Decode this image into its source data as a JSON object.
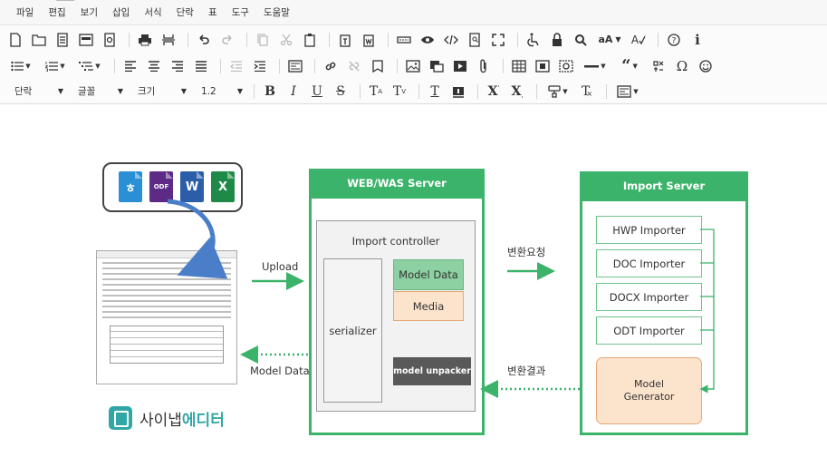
{
  "menubar": {
    "items": [
      "파일",
      "편집",
      "보기",
      "삽입",
      "서식",
      "단락",
      "표",
      "도구",
      "도움말"
    ]
  },
  "toolbar3": {
    "paragraph": "단락",
    "font": "글꼴",
    "size": "크기",
    "line_height": "1.2"
  },
  "diagram": {
    "file_icons": {
      "hwp": "ㅎ",
      "odf": "ODF",
      "word": "W",
      "excel": "X"
    },
    "brand": {
      "part1": "사이냅 ",
      "part2": "에디터"
    },
    "labels": {
      "upload": "Upload",
      "model_data_return": "Model Data",
      "convert_request": "변환요청",
      "convert_result": "변환결과"
    },
    "web_server": {
      "title": "WEB/WAS Server",
      "controller": "Import controller",
      "serializer": "serializer",
      "model_data": "Model Data",
      "media": "Media",
      "unpacker": "model unpacker"
    },
    "import_server": {
      "title": "Import Server",
      "importers": [
        "HWP Importer",
        "DOC Importer",
        "DOCX Importer",
        "ODT Importer"
      ],
      "generator_line1": "Model",
      "generator_line2": "Generator"
    }
  },
  "colors": {
    "green": "#3bb36a",
    "model_data_fill": "#8dd0a1",
    "media_fill": "#fce3cc",
    "unpacker_fill": "#595959",
    "brand_teal": "#30a7a5",
    "arrow_blue": "#4a7ec9"
  }
}
